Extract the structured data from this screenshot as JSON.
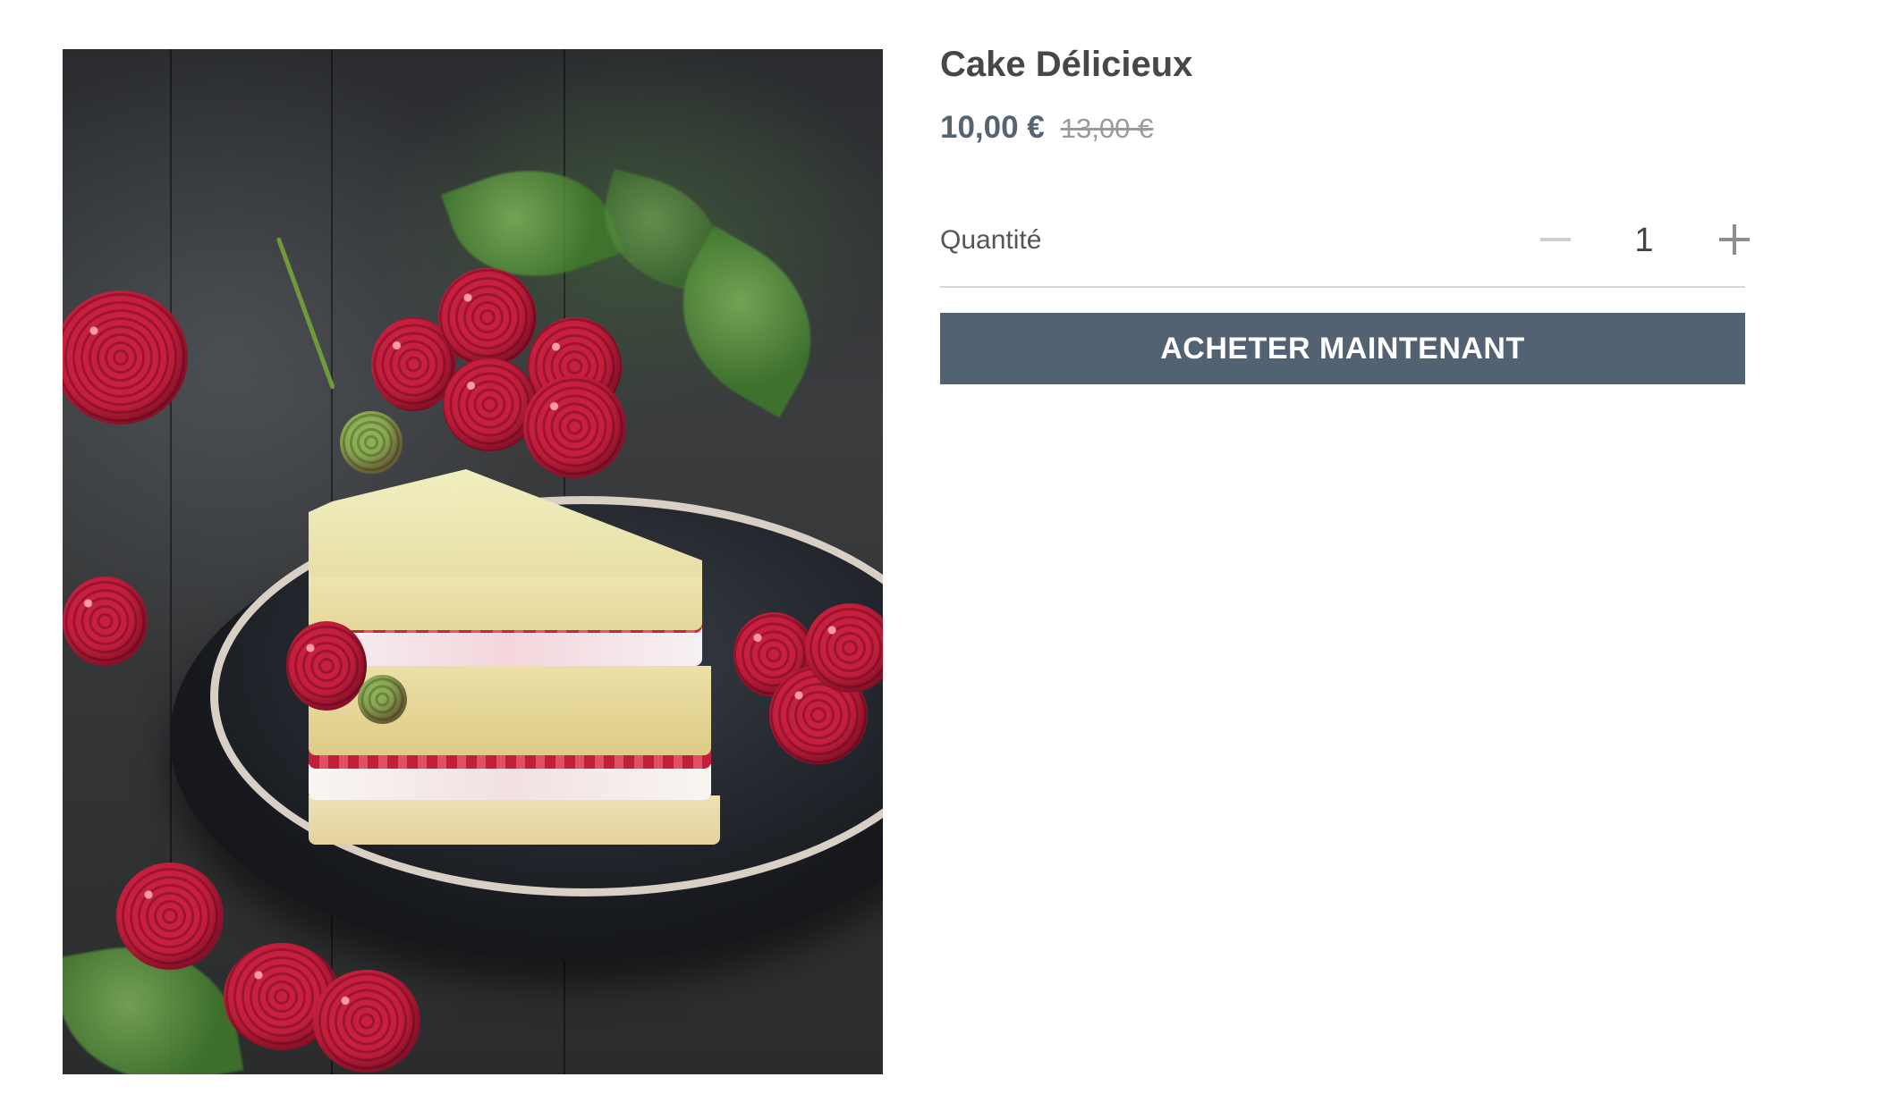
{
  "product": {
    "image_subject": "cake-slice-with-raspberries",
    "title": "Cake Délicieux",
    "price_current": "10,00 €",
    "price_old": "13,00 €"
  },
  "quantity": {
    "label": "Quantité",
    "value": "1",
    "minus_icon": "minus-icon",
    "plus_icon": "plus-icon"
  },
  "actions": {
    "buy_label": "ACHETER MAINTENANT"
  },
  "colors": {
    "accent": "#536272",
    "price": "#556373",
    "title": "#474747",
    "divider": "#d6d6d6"
  }
}
